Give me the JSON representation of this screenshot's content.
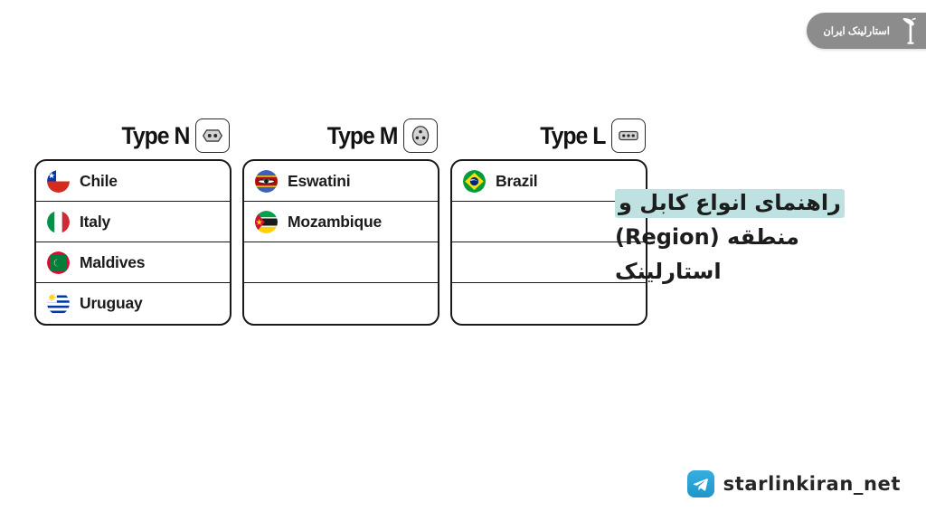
{
  "brand_badge": {
    "text": "استارلینک ایران",
    "icon": "satellite-dish-icon",
    "background_color": "#8c8c8c",
    "text_color": "#ffffff"
  },
  "headline": {
    "line1": "راهنمای انواع کابل و",
    "line2": "منطقه (Region)",
    "line3": "استارلینک",
    "highlight_color": "#bfe1e2",
    "text_color": "#1d1d1d"
  },
  "columns": [
    {
      "title": "Type N",
      "socket_icon": "socket-type-n-icon",
      "rows": [
        {
          "flag": "flag-chile",
          "name": "Chile"
        },
        {
          "flag": "flag-italy",
          "name": "Italy"
        },
        {
          "flag": "flag-maldives",
          "name": "Maldives"
        },
        {
          "flag": "flag-uruguay",
          "name": "Uruguay"
        }
      ]
    },
    {
      "title": "Type M",
      "socket_icon": "socket-type-m-icon",
      "rows": [
        {
          "flag": "flag-eswatini",
          "name": "Eswatini"
        },
        {
          "flag": "flag-mozambique",
          "name": "Mozambique"
        },
        {
          "flag": "",
          "name": ""
        },
        {
          "flag": "",
          "name": ""
        }
      ]
    },
    {
      "title": "Type L",
      "socket_icon": "socket-type-l-icon",
      "rows": [
        {
          "flag": "flag-brazil",
          "name": "Brazil"
        },
        {
          "flag": "",
          "name": ""
        },
        {
          "flag": "",
          "name": ""
        },
        {
          "flag": "",
          "name": ""
        }
      ]
    }
  ],
  "telegram": {
    "handle": "starlinkiran_net",
    "icon": "telegram-icon",
    "icon_color": "#2aa3dc"
  }
}
